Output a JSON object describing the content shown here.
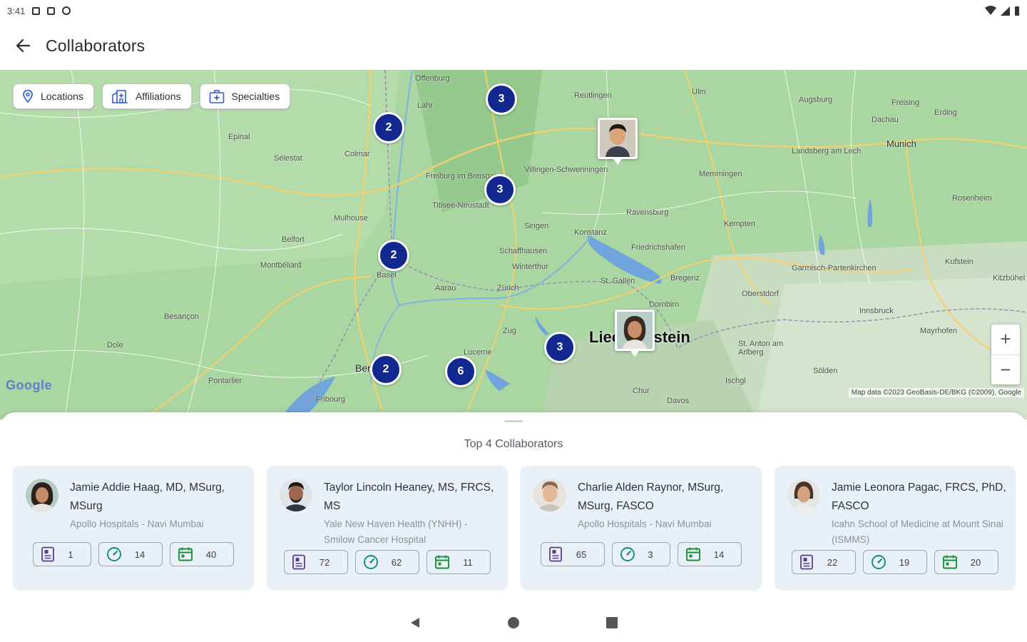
{
  "status_bar": {
    "time": "3:41"
  },
  "app_bar": {
    "title": "Collaborators"
  },
  "map": {
    "filters": [
      {
        "label": "Locations",
        "icon": "location-pin-icon"
      },
      {
        "label": "Affiliations",
        "icon": "hospital-building-icon"
      },
      {
        "label": "Specialties",
        "icon": "medical-kit-icon"
      }
    ],
    "clusters": [
      "3",
      "2",
      "3",
      "2",
      "3",
      "2",
      "6"
    ],
    "region_label": "Liechtenstein",
    "cities": [
      "Offenburg",
      "Reutlingen",
      "Ulm",
      "Augsburg",
      "Freising",
      "Erding",
      "Dachau",
      "Munich",
      "Lahr",
      "Colmar",
      "Sélestat",
      "Epinal",
      "Freiburg im Breisgau",
      "Titisee-Neustadt",
      "Villingen-Schwenningen",
      "Memmingen",
      "Landsberg am Lech",
      "Rosenheim",
      "Mulhouse",
      "Belfort",
      "Singen",
      "Konstanz",
      "Ravensburg",
      "Kempten",
      "Friedrichshafen",
      "Schaffhausen",
      "Winterthur",
      "Zürich",
      "Aarau",
      "Basel",
      "Montbéliard",
      "St. Gallen",
      "Bregenz",
      "Dornbirn",
      "Oberstdorf",
      "Garmisch-Partenkirchen",
      "Kufstein",
      "Kitzbühel",
      "Innsbruck",
      "Mayrhofen",
      "Besançon",
      "Zug",
      "Lucerne",
      "Chur",
      "Davos",
      "St. Anton am Arlberg",
      "Sölden",
      "Ischgl",
      "Dole",
      "Pontarlier",
      "Fribourg",
      "Bern"
    ],
    "attribution": "Map data ©2023 GeoBasis-DE/BKG (©2009), Google",
    "google_logo": "Google",
    "zoom_in": "+",
    "zoom_out": "−"
  },
  "sheet": {
    "title": "Top 4 Collaborators",
    "cards": [
      {
        "name": "Jamie Addie Haag, MD, MSurg, MSurg",
        "affiliation": "Apollo Hospitals - Navi Mumbai",
        "stats": {
          "publications": "1",
          "trials": "14",
          "events": "40"
        }
      },
      {
        "name": "Taylor Lincoln Heaney, MS, FRCS, MS",
        "affiliation": "Yale New Haven Health (YNHH) - Smilow Cancer Hospital",
        "stats": {
          "publications": "72",
          "trials": "62",
          "events": "11"
        }
      },
      {
        "name": "Charlie Alden Raynor, MSurg, MSurg, FASCO",
        "affiliation": "Apollo Hospitals - Navi Mumbai",
        "stats": {
          "publications": "65",
          "trials": "3",
          "events": "14"
        }
      },
      {
        "name": "Jamie Leonora Pagac, FRCS, PhD, FASCO",
        "affiliation": "Icahn School of Medicine at Mount Sinai (ISMMS)",
        "stats": {
          "publications": "22",
          "trials": "19",
          "events": "20"
        }
      }
    ]
  },
  "colors": {
    "cluster": "#13288f",
    "card_bg": "#eaf0f8",
    "stat_publications": "#5b3d8f",
    "stat_trials": "#0e8f6e",
    "stat_events": "#1a8f3c",
    "map_land": "#a8d5a0",
    "lake": "#6fa4dd"
  }
}
